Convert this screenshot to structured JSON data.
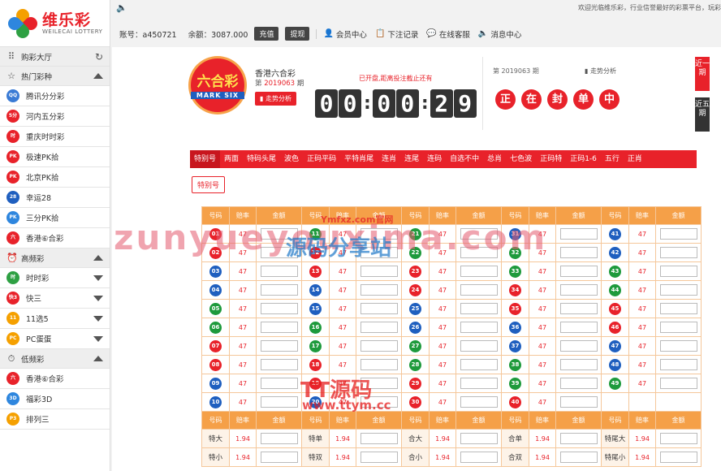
{
  "brand": {
    "name_cn": "维乐彩",
    "name_en": "WEILECAI LOTTERY"
  },
  "topbar": {
    "welcome": "欢迎光临维乐彩，行业信誉最好的彩票平台，玩彩",
    "account": "账号：a450721",
    "balance": "余额：3087.000",
    "deposit": "充值",
    "withdraw": "提现",
    "links": [
      "会员中心",
      "下注记录",
      "在线客服",
      "消息中心"
    ]
  },
  "sidebar": {
    "lobby": "购彩大厅",
    "groups": [
      {
        "title": "热门彩种",
        "items": [
          {
            "label": "腾讯分分彩",
            "badge": "QQ",
            "color": "#3a7bd5"
          },
          {
            "label": "河内五分彩",
            "badge": "5分",
            "color": "#e8222a"
          },
          {
            "label": "重庆时时彩",
            "badge": "时",
            "color": "#e8222a"
          },
          {
            "label": "极速PK拾",
            "badge": "PK",
            "color": "#e8222a"
          },
          {
            "label": "北京PK拾",
            "badge": "PK",
            "color": "#e8222a"
          },
          {
            "label": "幸运28",
            "badge": "28",
            "color": "#1f5fbf"
          },
          {
            "label": "三分PK拾",
            "badge": "PK",
            "color": "#2e86de"
          },
          {
            "label": "香港⑥合彩",
            "badge": "六",
            "color": "#e8222a"
          }
        ]
      },
      {
        "title": "高频彩",
        "items": [
          {
            "label": "时时彩",
            "badge": "时",
            "color": "#2ea043"
          },
          {
            "label": "快三",
            "badge": "快3",
            "color": "#e8222a"
          },
          {
            "label": "11选5",
            "badge": "11",
            "color": "#f5a000"
          },
          {
            "label": "PC蛋蛋",
            "badge": "PC",
            "color": "#f5a000"
          }
        ]
      },
      {
        "title": "低频彩",
        "items": [
          {
            "label": "香港⑥合彩",
            "badge": "六",
            "color": "#e8222a"
          },
          {
            "label": "福彩3D",
            "badge": "3D",
            "color": "#2e86de"
          },
          {
            "label": "排列三",
            "badge": "P3",
            "color": "#f5a000"
          }
        ]
      }
    ]
  },
  "game": {
    "logo_text": "六合彩",
    "logo_sub": "MARK SIX",
    "name": "香港六合彩",
    "period_pre": "第",
    "period": "2019063",
    "period_post": "期",
    "trend": "走势分析",
    "status": "已开盘,距离投注截止还有",
    "countdown": [
      "0",
      "0",
      "0",
      "0",
      "2",
      "9"
    ],
    "prev_period": "第 2019063 期",
    "prev_trend": "走势分析",
    "result_chars": [
      "正",
      "在",
      "封",
      "单",
      "中"
    ],
    "side_tabs": [
      "近一期",
      "近五期"
    ]
  },
  "play_tabs": [
    "特别号",
    "两面",
    "特码头尾",
    "波色",
    "正码平码",
    "平特肖尾",
    "连肖",
    "连尾",
    "连码",
    "自选不中",
    "总肖",
    "七色波",
    "正码特",
    "正码1-6",
    "五行",
    "正肖"
  ],
  "sub_tab": "特别号",
  "table": {
    "headers": [
      "号码",
      "赔率",
      "金额"
    ],
    "odds": "47",
    "numbers": [
      [
        "01",
        "r"
      ],
      [
        "02",
        "r"
      ],
      [
        "03",
        "b"
      ],
      [
        "04",
        "b"
      ],
      [
        "05",
        "g"
      ],
      [
        "06",
        "g"
      ],
      [
        "07",
        "r"
      ],
      [
        "08",
        "r"
      ],
      [
        "09",
        "b"
      ],
      [
        "10",
        "b"
      ],
      [
        "11",
        "g"
      ],
      [
        "12",
        "r"
      ],
      [
        "13",
        "r"
      ],
      [
        "14",
        "b"
      ],
      [
        "15",
        "b"
      ],
      [
        "16",
        "g"
      ],
      [
        "17",
        "g"
      ],
      [
        "18",
        "r"
      ],
      [
        "19",
        "r"
      ],
      [
        "20",
        "b"
      ],
      [
        "21",
        "g"
      ],
      [
        "22",
        "g"
      ],
      [
        "23",
        "r"
      ],
      [
        "24",
        "r"
      ],
      [
        "25",
        "b"
      ],
      [
        "26",
        "b"
      ],
      [
        "27",
        "g"
      ],
      [
        "28",
        "g"
      ],
      [
        "29",
        "r"
      ],
      [
        "30",
        "r"
      ],
      [
        "31",
        "b"
      ],
      [
        "32",
        "g"
      ],
      [
        "33",
        "g"
      ],
      [
        "34",
        "r"
      ],
      [
        "35",
        "r"
      ],
      [
        "36",
        "b"
      ],
      [
        "37",
        "b"
      ],
      [
        "38",
        "g"
      ],
      [
        "39",
        "g"
      ],
      [
        "40",
        "r"
      ],
      [
        "41",
        "b"
      ],
      [
        "42",
        "b"
      ],
      [
        "43",
        "g"
      ],
      [
        "44",
        "g"
      ],
      [
        "45",
        "r"
      ],
      [
        "46",
        "r"
      ],
      [
        "47",
        "b"
      ],
      [
        "48",
        "b"
      ],
      [
        "49",
        "g"
      ]
    ],
    "two_side_odds": "1.94",
    "two_side": [
      [
        "特大",
        "特单",
        "合大",
        "合单",
        "特尾大"
      ],
      [
        "特小",
        "特双",
        "合小",
        "合双",
        "特尾小"
      ]
    ]
  },
  "watermarks": {
    "w1": "zunyueyouxima.com",
    "w2": "源码分享站",
    "w3": "Ymfxz.com官网",
    "w4": "TT源码",
    "w5": "www.ttym.cc"
  }
}
